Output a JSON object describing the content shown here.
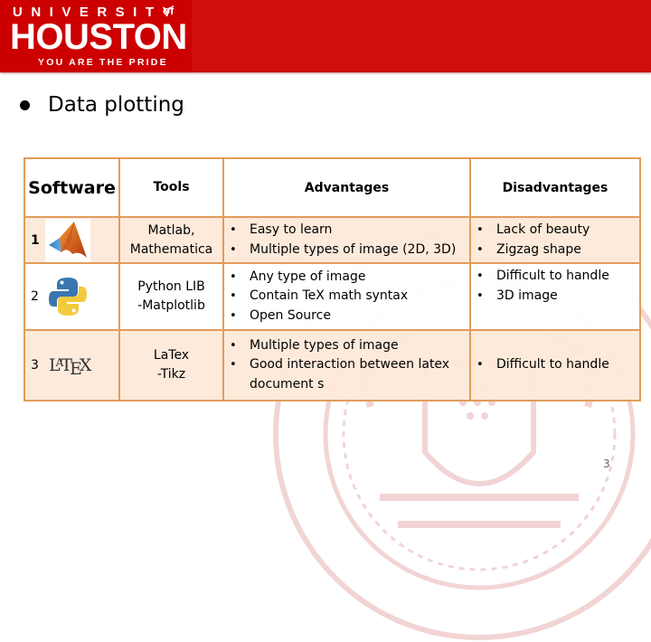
{
  "header": {
    "logo": {
      "line1": "UNIVERSITY",
      "of": "of",
      "line2": "HOUSTON",
      "tagline": "YOU ARE THE PRIDE"
    },
    "band_color": "#d00e0e"
  },
  "slide": {
    "title": "Data plotting",
    "page_number": "3"
  },
  "table": {
    "headers": {
      "software": "Software",
      "tools": "Tools",
      "advantages": "Advantages",
      "disadvantages": "Disadvantages"
    },
    "border_color": "#e29c5a",
    "shade_color": "#fde9d9",
    "rows": [
      {
        "num": "1",
        "icon": "matlab-logo-icon",
        "tools_line1": "Matlab,",
        "tools_line2": "Mathematica",
        "advantages": [
          "Easy to learn",
          "Multiple types of image (2D, 3D)"
        ],
        "disadvantages": [
          "Lack of beauty",
          "Zigzag shape"
        ]
      },
      {
        "num": "2",
        "icon": "python-logo-icon",
        "tools_line1": "Python LIB",
        "tools_line2": "-Matplotlib",
        "advantages": [
          "Any type of image",
          "Contain TeX math syntax",
          "Open Source"
        ],
        "disadvantages": [
          "Difficult to handle",
          "3D image"
        ]
      },
      {
        "num": "3",
        "icon": "latex-logo-icon",
        "tools_line1": "LaTex",
        "tools_line2": "-Tikz",
        "advantages": [
          "Multiple types of image",
          "Good interaction between latex document s"
        ],
        "disadvantages": [
          "Difficult to handle"
        ]
      }
    ]
  }
}
